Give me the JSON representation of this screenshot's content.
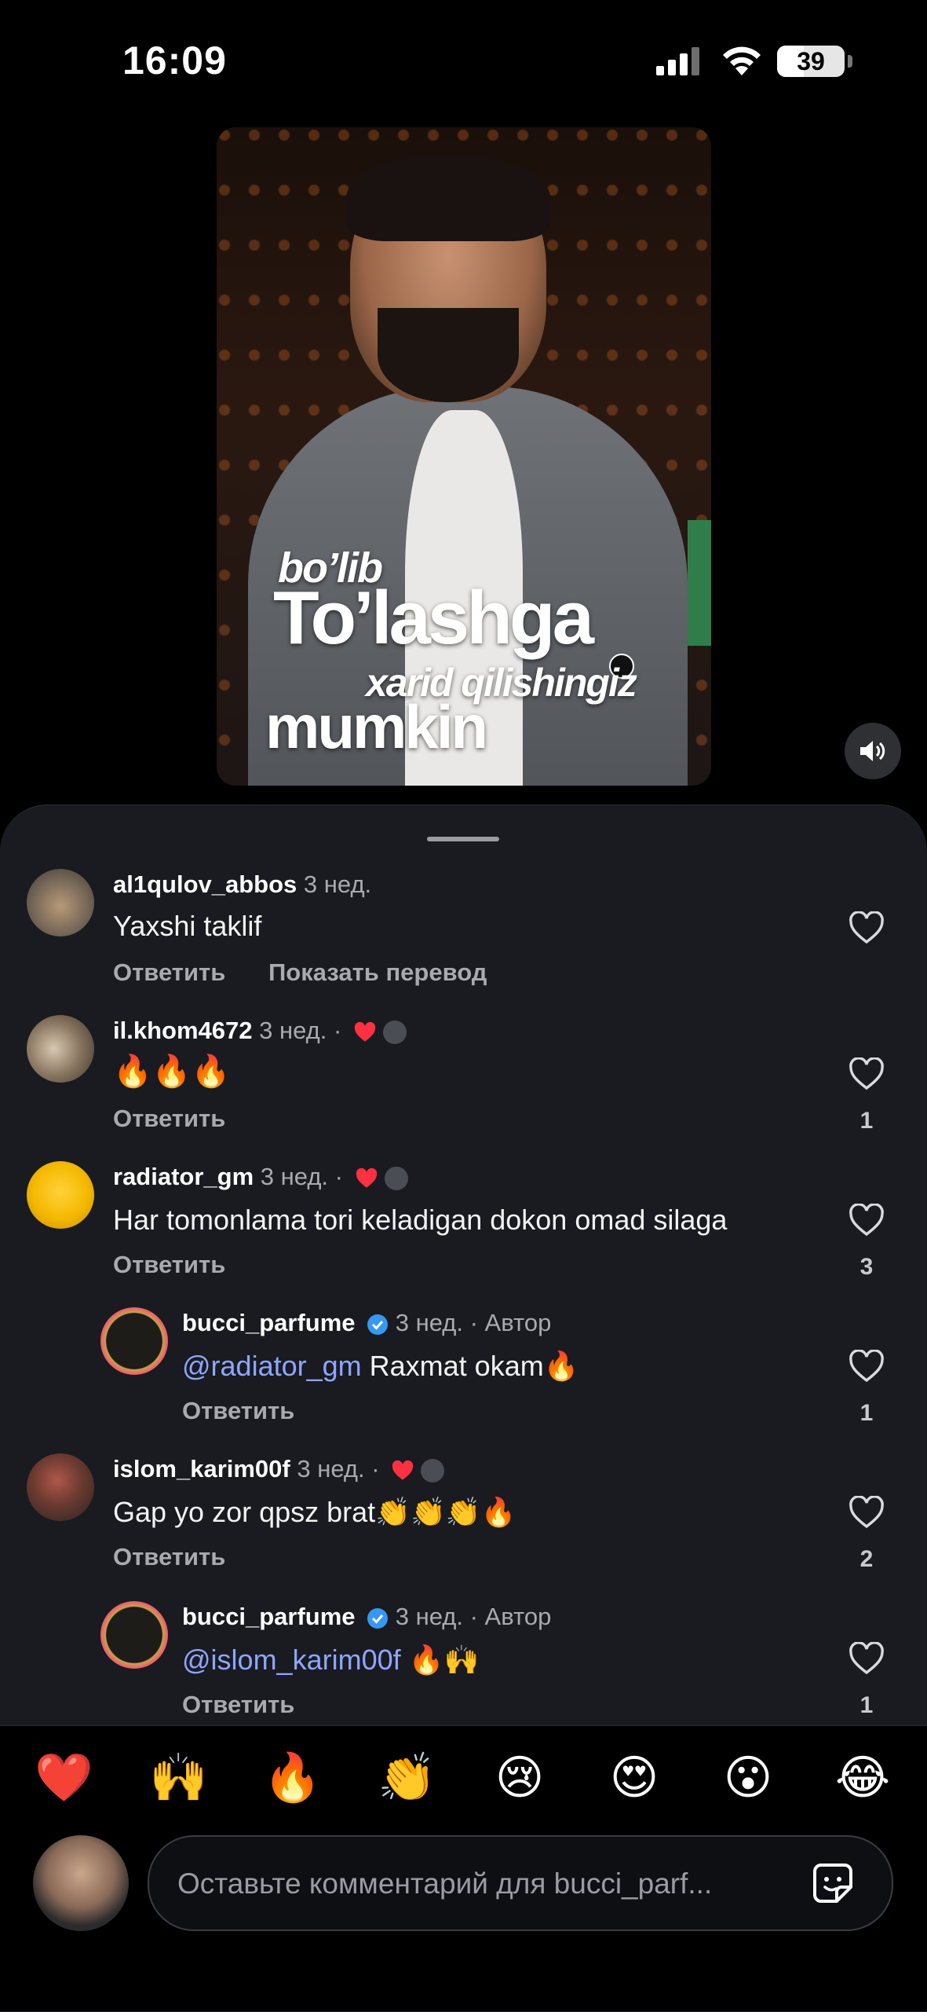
{
  "status_bar": {
    "time": "16:09",
    "battery_percent": "39",
    "battery_level": 0.39
  },
  "video": {
    "overlay_lines": [
      "bo’lib",
      "To’lashga",
      "xarid qilishingiz",
      "mumkin"
    ]
  },
  "comments": [
    {
      "username": "al1qulov_abbos",
      "time": "3 нед.",
      "text": "Yaxshi taklif",
      "reply_label": "Ответить",
      "translate_label": "Показать перевод",
      "likes": ""
    },
    {
      "username": "il.khom4672",
      "time": "3 нед. ·",
      "text": "🔥🔥🔥",
      "reply_label": "Ответить",
      "likes": "1"
    },
    {
      "username": "radiator_gm",
      "time": "3 нед. ·",
      "text": "Har tomonlama tori keladigan dokon omad silaga",
      "reply_label": "Ответить",
      "likes": "3"
    },
    {
      "username": "bucci_parfume",
      "time": "3 нед. · Автор",
      "mention": "@radiator_gm",
      "text": " Raxmat okam🔥",
      "reply_label": "Ответить",
      "likes": "1"
    },
    {
      "username": "islom_karim00f",
      "time": "3 нед. ·",
      "text": "Gap yo zor qpsz brat👏👏👏🔥",
      "reply_label": "Ответить",
      "likes": "2"
    },
    {
      "username": "bucci_parfume",
      "time": "3 нед. · Автор",
      "mention": "@islom_karim00f",
      "text": " 🔥🙌",
      "reply_label": "Ответить",
      "likes": "1"
    }
  ],
  "emoji_bar": [
    "❤️",
    "🙌",
    "🔥",
    "👏",
    "😢",
    "😍",
    "😮",
    "😂"
  ],
  "composer": {
    "placeholder": "Оставьте комментарий для bucci_parf..."
  },
  "colors": {
    "sheet_bg": "#191b20",
    "mention": "#8fa6ff",
    "heart_red": "#ff3040",
    "verified_blue": "#3897f0"
  }
}
